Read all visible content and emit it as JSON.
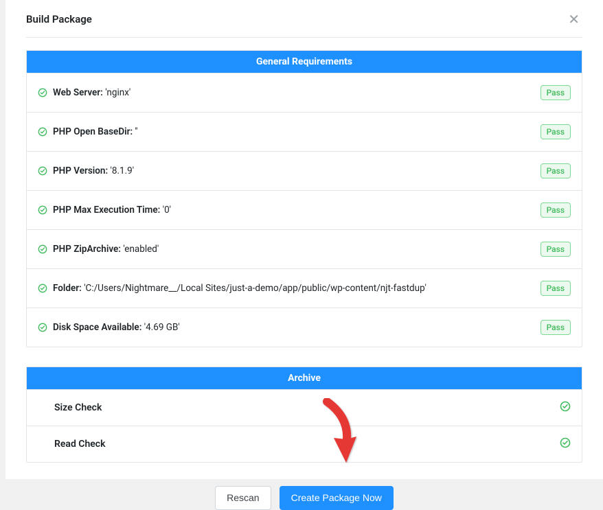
{
  "modal": {
    "title": "Build Package",
    "close": "✕"
  },
  "sections": {
    "general": {
      "title": "General Requirements",
      "rows": [
        {
          "label": "Web Server: ",
          "value": "'nginx'",
          "status": "Pass"
        },
        {
          "label": "PHP Open BaseDir: ",
          "value": "''",
          "status": "Pass"
        },
        {
          "label": "PHP Version: ",
          "value": "'8.1.9'",
          "status": "Pass"
        },
        {
          "label": "PHP Max Execution Time: ",
          "value": "'0'",
          "status": "Pass"
        },
        {
          "label": "PHP ZipArchive: ",
          "value": "'enabled'",
          "status": "Pass"
        },
        {
          "label": "Folder: ",
          "value": "'C:/Users/Nightmare__/Local Sites/just-a-demo/app/public/wp-content/njt-fastdup'",
          "status": "Pass"
        },
        {
          "label": "Disk Space Available: ",
          "value": "'4.69 GB'",
          "status": "Pass"
        }
      ]
    },
    "archive": {
      "title": "Archive",
      "rows": [
        {
          "label": "Size Check"
        },
        {
          "label": "Read Check"
        }
      ]
    }
  },
  "footer": {
    "rescan": "Rescan",
    "create": "Create Package Now"
  }
}
